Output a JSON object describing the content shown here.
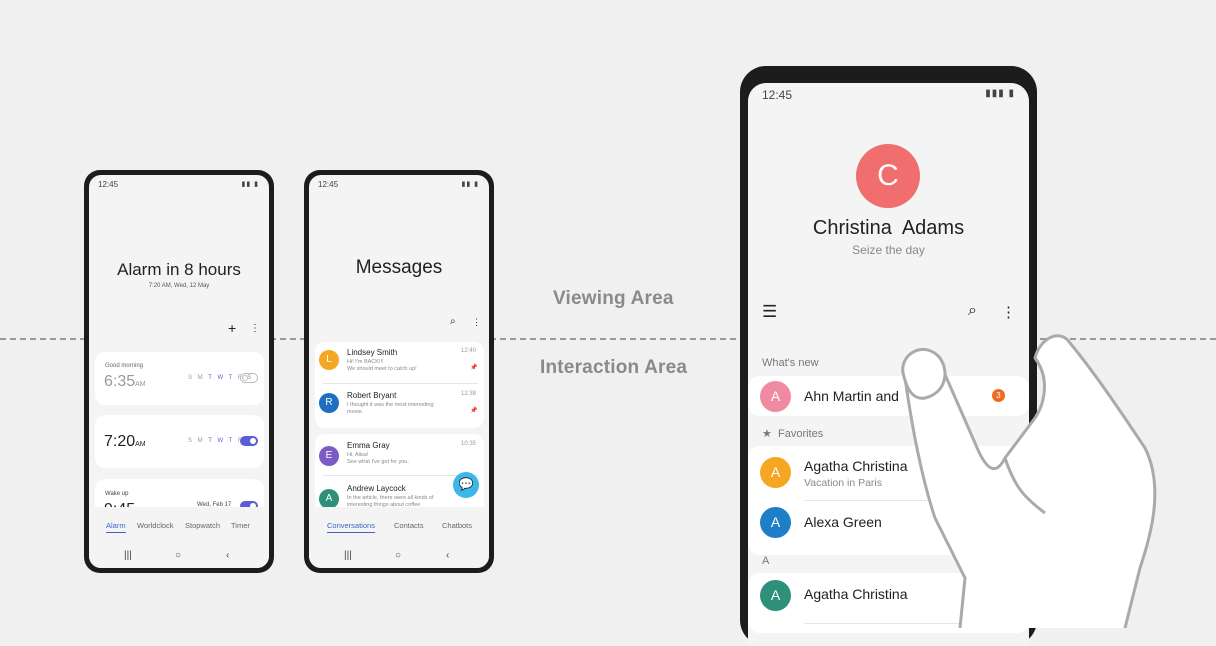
{
  "labels": {
    "viewing_area": "Viewing Area",
    "interaction_area": "Interaction Area"
  },
  "clock_phone": {
    "status_time": "12:45",
    "title": "Alarm in 8 hours",
    "subtitle": "7:20 AM, Wed, 12 May",
    "alarms": [
      {
        "label": "Good morning",
        "time": "6:35",
        "ampm": "AM",
        "days_plain": "S M ",
        "days_active": "T W T",
        "days_tail": " F S",
        "on": false
      },
      {
        "label": "",
        "time": "7:20",
        "ampm": "AM",
        "days_plain": "S M ",
        "days_active": "T W T",
        "days_tail": " F S",
        "on": true
      },
      {
        "label": "Wake up",
        "time": "9:45",
        "ampm": "",
        "date": "Wed, Feb 17",
        "on": true
      }
    ],
    "tabs": [
      "Alarm",
      "Worldclock",
      "Stopwatch",
      "Timer"
    ],
    "active_tab": "Alarm",
    "add_icon": "+",
    "more_icon": "⋮"
  },
  "messages_phone": {
    "status_time": "12:45",
    "title": "Messages",
    "conversations": [
      {
        "initial": "L",
        "name": "Lindsey Smith",
        "preview1": "Hi! I'm BACK!!!",
        "preview2": "We should meet to catch up!",
        "time": "12:40",
        "color": "#f5a623",
        "pinned": true
      },
      {
        "initial": "R",
        "name": "Robert Bryant",
        "preview1": "I thought it was the most interesting",
        "preview2": "movie.",
        "time": "12:38",
        "color": "#1e6fbf",
        "pinned": true
      },
      {
        "initial": "E",
        "name": "Emma Gray",
        "preview1": "Hi, Alisa!",
        "preview2": "See what I've got for you.",
        "time": "10:35",
        "color": "#7b5cc4",
        "pinned": false
      },
      {
        "initial": "A",
        "name": "Andrew Laycock",
        "preview1": "In the article, there were all kinds of",
        "preview2": "interesting things about coffee",
        "time": "",
        "color": "#2e8f7a",
        "pinned": false
      }
    ],
    "tabs": [
      "Conversations",
      "Contacts",
      "Chatbots"
    ],
    "active_tab": "Conversations"
  },
  "contacts_phone": {
    "status_time": "12:45",
    "profile_initial": "C",
    "profile_name": "Christina  Adams",
    "profile_status": "Seize the day",
    "sections": {
      "whats_new": "What's new",
      "favorites": "Favorites",
      "letter_a": "A"
    },
    "whats_new_item": {
      "initial": "A",
      "name": "Ahn Martin and",
      "badge": "3"
    },
    "favorites": [
      {
        "initial": "A",
        "name": "Agatha Christina",
        "sub": "Vacation in Paris"
      },
      {
        "initial": "A",
        "name": "Alexa Green",
        "sub": ""
      }
    ],
    "a_list": [
      {
        "initial": "A",
        "name": "Agatha Christina"
      }
    ]
  },
  "colors": {
    "accent": "#3c64c8",
    "toggle_on": "#5b5fd6",
    "profile_red": "#f06e6e",
    "badge_orange": "#f06a1e",
    "fab_blue": "#3db7e8"
  }
}
